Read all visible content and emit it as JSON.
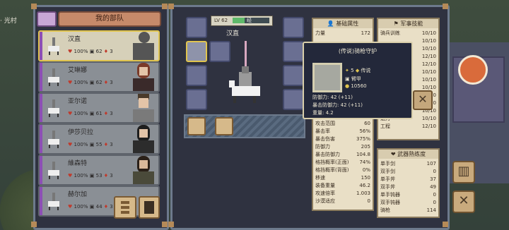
{
  "location_label": "· 光村",
  "party": {
    "title": "我的部队",
    "units": [
      {
        "name": "汉直",
        "hp": "100%",
        "armor": "62",
        "count": "3"
      },
      {
        "name": "艾琳娜",
        "hp": "100%",
        "armor": "62",
        "count": "3"
      },
      {
        "name": "亚尔诺",
        "hp": "100%",
        "armor": "61",
        "count": "3"
      },
      {
        "name": "伊莎贝拉",
        "hp": "100%",
        "armor": "55",
        "count": "3"
      },
      {
        "name": "維森特",
        "hp": "100%",
        "armor": "53",
        "count": "3"
      },
      {
        "name": "赫尔加",
        "hp": "100%",
        "armor": "44",
        "count": "3"
      }
    ]
  },
  "hero": {
    "level_label": "LV 62",
    "xp_label": "经",
    "xp_fraction": 0.32,
    "name": "汉直"
  },
  "attributes": {
    "title": "基础属性",
    "top_rows": [
      {
        "k": "力量",
        "v": "172"
      }
    ],
    "rows": [
      {
        "k": "攻击范围",
        "v": "60"
      },
      {
        "k": "暴击率",
        "v": "56%"
      },
      {
        "k": "暴击伤害",
        "v": "375%"
      },
      {
        "k": "防御力",
        "v": "205"
      },
      {
        "k": "暴击防御力",
        "v": "104.8"
      },
      {
        "k": "格挡概率(正面)",
        "v": "74%"
      },
      {
        "k": "格挡概率(背面)",
        "v": "0%"
      },
      {
        "k": "移速",
        "v": "150"
      },
      {
        "k": "装备重量",
        "v": "46.2"
      },
      {
        "k": "攻速倍率",
        "v": "1.003"
      },
      {
        "k": "沙漠适应",
        "v": "0"
      }
    ]
  },
  "military": {
    "title": "军事技能",
    "rows": [
      {
        "k": "骑兵训练",
        "v": "10/10"
      },
      {
        "k": "",
        "v": "10/10"
      },
      {
        "k": "",
        "v": "10/10"
      },
      {
        "k": "",
        "v": "12/10"
      },
      {
        "k": "",
        "v": "12/10"
      },
      {
        "k": "",
        "v": "10/10"
      },
      {
        "k": "",
        "v": "10/10"
      },
      {
        "k": "",
        "v": "10/10"
      },
      {
        "k": "",
        "v": "10/10"
      },
      {
        "k": "",
        "v": "10/10"
      },
      {
        "k": "",
        "v": "10/10"
      },
      {
        "k": "魅力",
        "v": "10/10"
      },
      {
        "k": "工程",
        "v": "12/10"
      }
    ]
  },
  "weapons": {
    "title": "武器熟练度",
    "rows": [
      {
        "k": "单手剑",
        "v": "107"
      },
      {
        "k": "双手剑",
        "v": "0"
      },
      {
        "k": "单手斧",
        "v": "37"
      },
      {
        "k": "双手斧",
        "v": "49"
      },
      {
        "k": "单手钝器",
        "v": "0"
      },
      {
        "k": "双手钝器",
        "v": "0"
      },
      {
        "k": "骑枪",
        "v": "114"
      }
    ]
  },
  "tooltip": {
    "title": "(传说)骑枪守护",
    "tier": "5",
    "rarity": "传说",
    "type": "臂甲",
    "price": "10560",
    "lines": [
      "防御力: 42 (+11)",
      "暴击防御力: 42 (+11)",
      "重量: 4.2"
    ]
  },
  "colors": {
    "accent": "#e0c44e",
    "panel": "#2f3240",
    "parchment": "#e9dfc6"
  }
}
